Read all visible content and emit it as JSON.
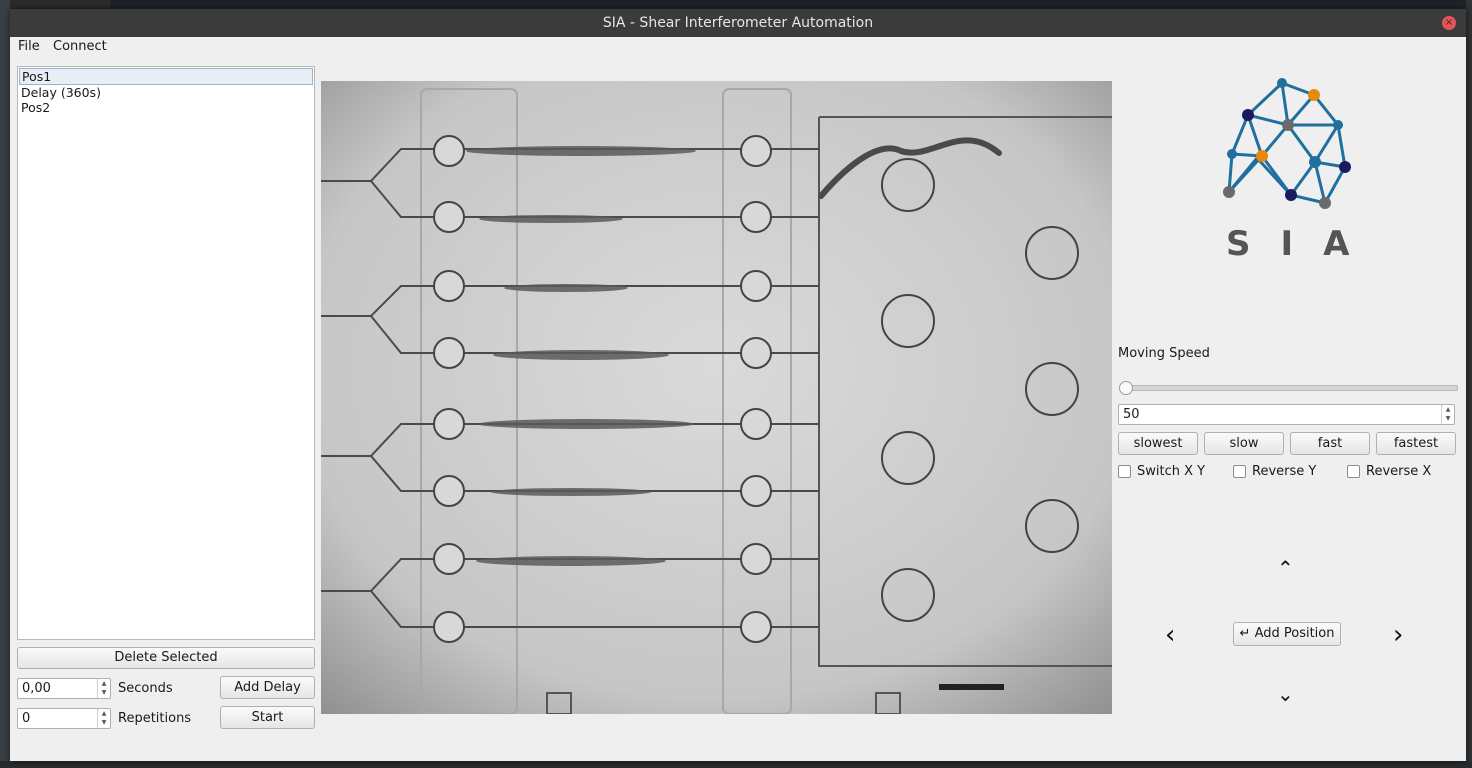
{
  "window": {
    "title": "SIA - Shear Interferometer Automation",
    "close_glyph": "×"
  },
  "menu": {
    "file": "File",
    "connect": "Connect"
  },
  "sequence_list": {
    "items": [
      "Pos1",
      "Delay (360s)",
      "Pos2"
    ],
    "selected_index": 0
  },
  "controls": {
    "delete_selected": "Delete Selected",
    "seconds_value": "0,00",
    "seconds_label": "Seconds",
    "add_delay": "Add Delay",
    "repetitions_value": "0",
    "repetitions_label": "Repetitions",
    "start": "Start"
  },
  "logo": {
    "text": "SIA",
    "colors": {
      "blue": "#1f6f9f",
      "orange": "#e8890e",
      "navy": "#1a1a5e",
      "gray": "#6a6a6a"
    }
  },
  "speed": {
    "label": "Moving Speed",
    "slider_value": 0,
    "value": "50",
    "buttons": [
      "slowest",
      "slow",
      "fast",
      "fastest"
    ]
  },
  "options": {
    "switch_xy": "Switch X Y",
    "reverse_y": "Reverse Y",
    "reverse_x": "Reverse X"
  },
  "navigation": {
    "up": "⌃",
    "down": "⌄",
    "left": "‹",
    "right": "›",
    "add_position_icon": "↵",
    "add_position": "Add Position"
  }
}
